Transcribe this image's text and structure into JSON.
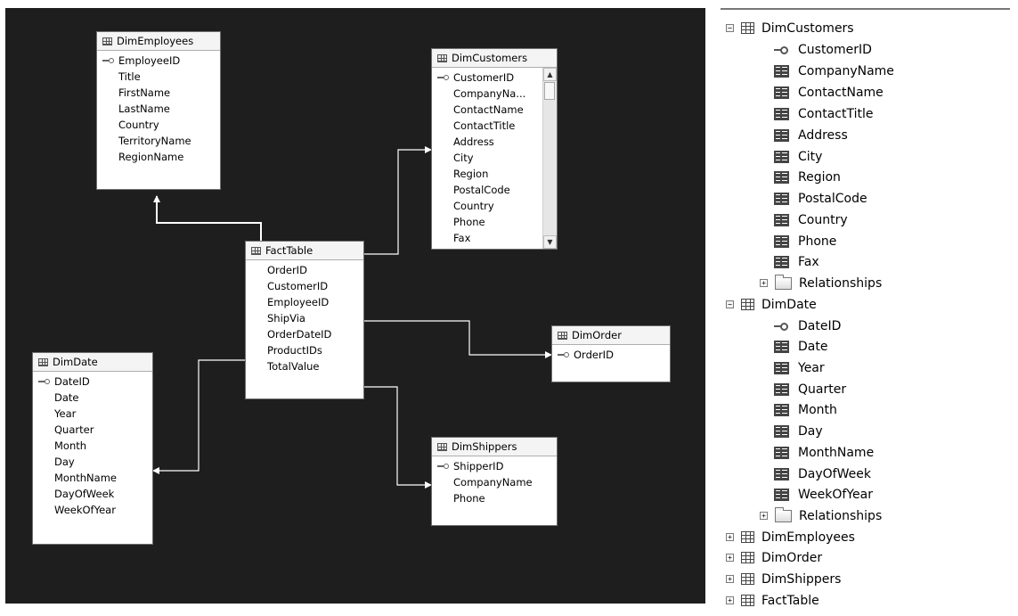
{
  "diagram": {
    "tables": {
      "dimEmployees": {
        "title": "DimEmployees",
        "key": "EmployeeID",
        "columns": [
          "Title",
          "FirstName",
          "LastName",
          "Country",
          "TerritoryName",
          "RegionName"
        ]
      },
      "dimCustomers": {
        "title": "DimCustomers",
        "key": "CustomerID",
        "columns": [
          "CompanyNa...",
          "ContactName",
          "ContactTitle",
          "Address",
          "City",
          "Region",
          "PostalCode",
          "Country",
          "Phone",
          "Fax"
        ]
      },
      "factTable": {
        "title": "FactTable",
        "columns": [
          "OrderID",
          "CustomerID",
          "EmployeeID",
          "ShipVia",
          "OrderDateID",
          "ProductIDs",
          "TotalValue"
        ]
      },
      "dimOrder": {
        "title": "DimOrder",
        "key": "OrderID"
      },
      "dimDate": {
        "title": "DimDate",
        "key": "DateID",
        "columns": [
          "Date",
          "Year",
          "Quarter",
          "Month",
          "Day",
          "MonthName",
          "DayOfWeek",
          "WeekOfYear"
        ]
      },
      "dimShippers": {
        "title": "DimShippers",
        "key": "ShipperID",
        "columns": [
          "CompanyName",
          "Phone"
        ]
      }
    }
  },
  "tree": {
    "dimCustomers": {
      "label": "DimCustomers",
      "key": "CustomerID",
      "columns": [
        "CompanyName",
        "ContactName",
        "ContactTitle",
        "Address",
        "City",
        "Region",
        "PostalCode",
        "Country",
        "Phone",
        "Fax"
      ],
      "relationships": "Relationships"
    },
    "dimDate": {
      "label": "DimDate",
      "key": "DateID",
      "columns": [
        "Date",
        "Year",
        "Quarter",
        "Month",
        "Day",
        "MonthName",
        "DayOfWeek",
        "WeekOfYear"
      ],
      "relationships": "Relationships"
    },
    "collapsed": [
      "DimEmployees",
      "DimOrder",
      "DimShippers",
      "FactTable"
    ],
    "expand_symbol": "+",
    "collapse_symbol": "−"
  },
  "colors": {
    "diagram_background": "#1e1e1e",
    "connector": "#ffffff",
    "table_border": "#6f6f6f"
  }
}
